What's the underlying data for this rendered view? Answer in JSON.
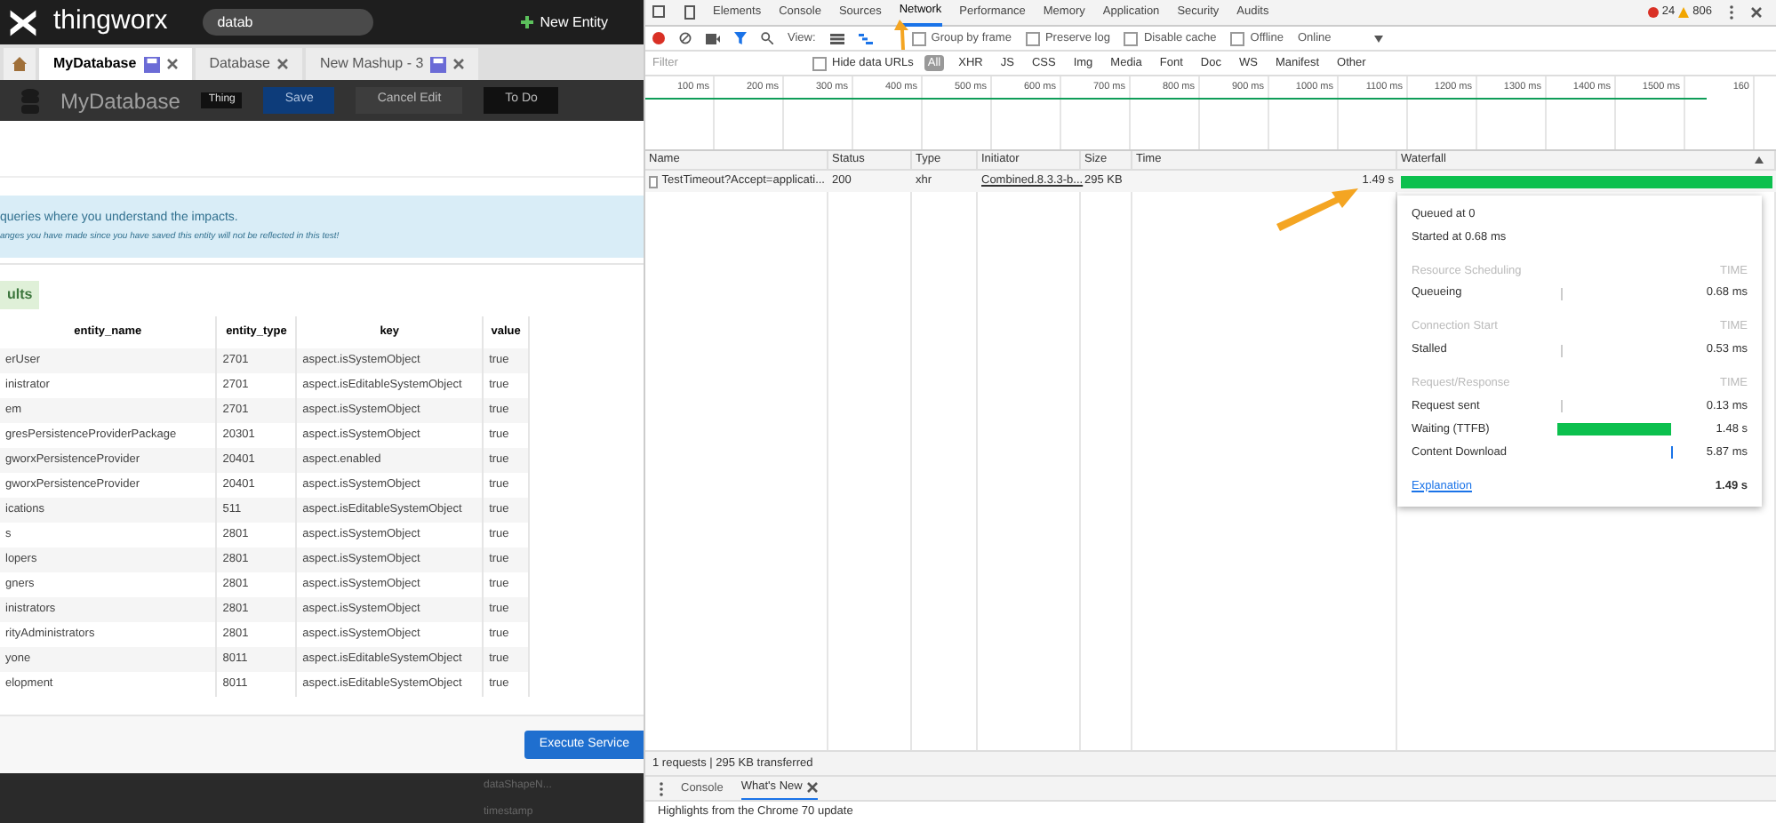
{
  "app": {
    "logo_text": "thingworx",
    "search": {
      "value": "datab"
    },
    "new_entity": "New Entity"
  },
  "tabs": [
    {
      "label": "MyDatabase",
      "selected": true,
      "unsaved": true
    },
    {
      "label": "Database",
      "selected": false,
      "unsaved": false
    },
    {
      "label": "New Mashup - 3",
      "selected": false,
      "unsaved": true
    }
  ],
  "entity_header": {
    "title": "MyDatabase",
    "badge": "Thing",
    "buttons": [
      "Save",
      "Cancel Edit",
      "To Do"
    ]
  },
  "notice": {
    "line1": "queries where you understand the impacts.",
    "line2": "anges you have made since you have saved this entity will not be reflected in this test!"
  },
  "results_tab": "ults",
  "results": {
    "columns": [
      "entity_name",
      "entity_type",
      "key",
      "value"
    ],
    "rows": [
      [
        "erUser",
        "2701",
        "aspect.isSystemObject",
        "true"
      ],
      [
        "inistrator",
        "2701",
        "aspect.isEditableSystemObject",
        "true"
      ],
      [
        "em",
        "2701",
        "aspect.isSystemObject",
        "true"
      ],
      [
        "gresPersistenceProviderPackage",
        "20301",
        "aspect.isSystemObject",
        "true"
      ],
      [
        "gworxPersistenceProvider",
        "20401",
        "aspect.enabled",
        "true"
      ],
      [
        "gworxPersistenceProvider",
        "20401",
        "aspect.isSystemObject",
        "true"
      ],
      [
        "ications",
        "511",
        "aspect.isEditableSystemObject",
        "true"
      ],
      [
        "s",
        "2801",
        "aspect.isSystemObject",
        "true"
      ],
      [
        "lopers",
        "2801",
        "aspect.isSystemObject",
        "true"
      ],
      [
        "gners",
        "2801",
        "aspect.isSystemObject",
        "true"
      ],
      [
        "inistrators",
        "2801",
        "aspect.isSystemObject",
        "true"
      ],
      [
        "rityAdministrators",
        "2801",
        "aspect.isSystemObject",
        "true"
      ],
      [
        "yone",
        "8011",
        "aspect.isEditableSystemObject",
        "true"
      ],
      [
        "elopment",
        "8011",
        "aspect.isEditableSystemObject",
        "true"
      ]
    ]
  },
  "execute_button": "Execute Service",
  "background_items": [
    "dataShapeN...",
    "timestamp"
  ],
  "devtools": {
    "panels": [
      {
        "label": "Elements",
        "selected": false
      },
      {
        "label": "Console",
        "selected": false
      },
      {
        "label": "Sources",
        "selected": false
      },
      {
        "label": "Network",
        "selected": true
      },
      {
        "label": "Performance",
        "selected": false
      },
      {
        "label": "Memory",
        "selected": false
      },
      {
        "label": "Application",
        "selected": false
      },
      {
        "label": "Security",
        "selected": false
      },
      {
        "label": "Audits",
        "selected": false
      }
    ],
    "errors": "24",
    "warnings": "806",
    "toolbar": {
      "view_label": "View:",
      "options": [
        {
          "label": "Group by frame",
          "checked": false
        },
        {
          "label": "Preserve log",
          "checked": false
        },
        {
          "label": "Disable cache",
          "checked": false
        },
        {
          "label": "Offline",
          "checked": false
        }
      ],
      "throttle": "Online"
    },
    "filter": {
      "placeholder": "Filter",
      "hide_data_urls": {
        "label": "Hide data URLs",
        "checked": false
      },
      "types": [
        {
          "label": "All",
          "selected": true
        },
        {
          "label": "XHR",
          "selected": false
        },
        {
          "label": "JS",
          "selected": false
        },
        {
          "label": "CSS",
          "selected": false
        },
        {
          "label": "Img",
          "selected": false
        },
        {
          "label": "Media",
          "selected": false
        },
        {
          "label": "Font",
          "selected": false
        },
        {
          "label": "Doc",
          "selected": false
        },
        {
          "label": "WS",
          "selected": false
        },
        {
          "label": "Manifest",
          "selected": false
        },
        {
          "label": "Other",
          "selected": false
        }
      ]
    },
    "overview_ticks": [
      "100 ms",
      "200 ms",
      "300 ms",
      "400 ms",
      "500 ms",
      "600 ms",
      "700 ms",
      "800 ms",
      "900 ms",
      "1000 ms",
      "1100 ms",
      "1200 ms",
      "1300 ms",
      "1400 ms",
      "1500 ms",
      "160"
    ],
    "columns": [
      "Name",
      "Status",
      "Type",
      "Initiator",
      "Size",
      "Time",
      "Waterfall"
    ],
    "requests": [
      {
        "name": "TestTimeout?Accept=applicati...",
        "status": "200",
        "type": "xhr",
        "initiator": "Combined.8.3.3-b...",
        "size": "295 KB",
        "time": "1.49 s"
      }
    ],
    "timing": {
      "queued": "Queued at 0",
      "started": "Started at 0.68 ms",
      "items": [
        {
          "kind": "section",
          "label": "Resource Scheduling",
          "value": "TIME"
        },
        {
          "kind": "tick",
          "label": "Queueing",
          "value": "0.68 ms"
        },
        {
          "kind": "section",
          "label": "Connection Start",
          "value": "TIME"
        },
        {
          "kind": "tick",
          "label": "Stalled",
          "value": "0.53 ms"
        },
        {
          "kind": "section",
          "label": "Request/Response",
          "value": "TIME"
        },
        {
          "kind": "tick",
          "label": "Request sent",
          "value": "0.13 ms"
        },
        {
          "kind": "bar",
          "label": "Waiting (TTFB)",
          "value": "1.48 s"
        },
        {
          "kind": "end",
          "label": "Content Download",
          "value": "5.87 ms"
        }
      ],
      "explanation": "Explanation",
      "total": "1.49 s"
    },
    "summary": "1 requests | 295 KB transferred",
    "drawer_tabs": [
      {
        "label": "Console",
        "selected": false,
        "closable": false
      },
      {
        "label": "What's New",
        "selected": true,
        "closable": true
      }
    ],
    "drawer_text": "Highlights from the Chrome 70 update"
  }
}
